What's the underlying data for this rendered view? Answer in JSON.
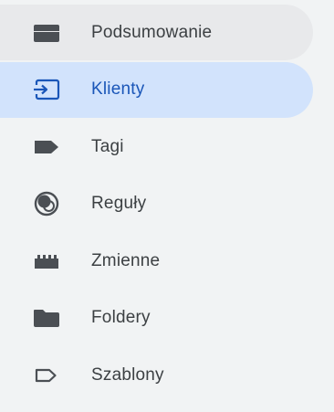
{
  "nav": {
    "items": [
      {
        "label": "Podsumowanie",
        "icon": "overview-icon",
        "state": "hovered"
      },
      {
        "label": "Klienty",
        "icon": "client-login-icon",
        "state": "selected"
      },
      {
        "label": "Tagi",
        "icon": "tag-icon",
        "state": "default"
      },
      {
        "label": "Reguły",
        "icon": "trigger-icon",
        "state": "default"
      },
      {
        "label": "Zmienne",
        "icon": "variables-icon",
        "state": "default"
      },
      {
        "label": "Foldery",
        "icon": "folder-icon",
        "state": "default"
      },
      {
        "label": "Szablony",
        "icon": "template-tag-outline-icon",
        "state": "default"
      }
    ]
  },
  "colors": {
    "background": "#f1f3f4",
    "hover": "#e8e9eb",
    "selected_bg": "#d2e3fc",
    "selected_fg": "#1a56b8",
    "text": "#3c4043",
    "icon": "#4b4f54"
  }
}
